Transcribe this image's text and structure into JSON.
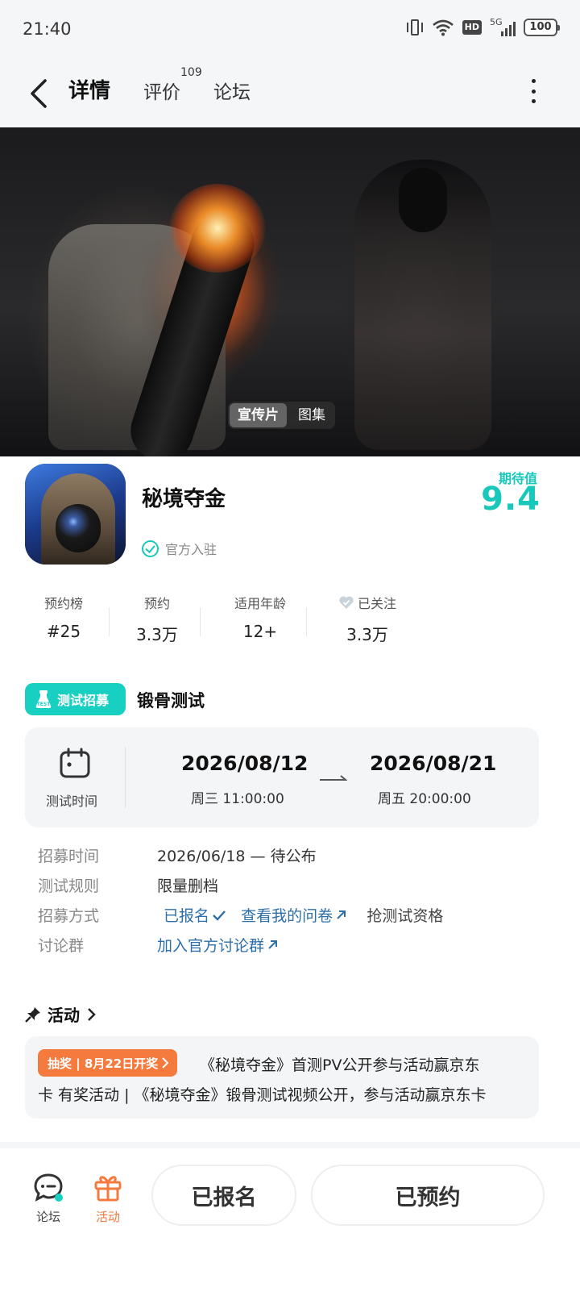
{
  "status_bar": {
    "time": "21:40",
    "hd": "HD",
    "network": "5G",
    "battery": "100"
  },
  "nav": {
    "tabs": [
      {
        "label": "详情"
      },
      {
        "label": "评价"
      },
      {
        "label": "论坛"
      }
    ],
    "review_count": "109"
  },
  "hero": {
    "media_tabs": [
      {
        "label": "宣传片"
      },
      {
        "label": "图集"
      }
    ]
  },
  "game": {
    "title": "秘境夺金",
    "official": "官方入驻",
    "expect_label": "期待值",
    "expect_score": "9.4"
  },
  "stats": [
    {
      "label": "预约榜",
      "value": "#25"
    },
    {
      "label": "预约",
      "value": "3.3万"
    },
    {
      "label": "适用年龄",
      "value": "12+"
    },
    {
      "label": "已关注",
      "value": "3.3万"
    }
  ],
  "test": {
    "badge": "测试招募",
    "name": "锻骨测试",
    "time_label": "测试时间",
    "start_date": "2026/08/12",
    "start_sub": "周三  11:00:00",
    "end_date": "2026/08/21",
    "end_sub": "周五  20:00:00",
    "details": [
      {
        "label": "招募时间",
        "value": "2026/06/18 — 待公布"
      },
      {
        "label": "测试规则",
        "value": "限量删档"
      },
      {
        "label": "招募方式",
        "signed": "已报名",
        "questionnaire": "查看我的问卷",
        "grab": "抢测试资格"
      },
      {
        "label": "讨论群",
        "value": "加入官方讨论群"
      }
    ]
  },
  "activity": {
    "title": "活动",
    "badge": "抽奖 | 8月22日开奖",
    "line1": "《秘境夺金》首测PV公开参与活动赢京东",
    "line2": "卡 有奖活动 | 《秘境夺金》锻骨测试视频公开，参与活动赢京东卡"
  },
  "bottom_bar": {
    "forum": "论坛",
    "activity": "活动",
    "signed_button": "已报名",
    "reserved_button": "已预约"
  },
  "colors": {
    "accent": "#17d0c2",
    "orange": "#f47a3d",
    "link": "#2d6fa8"
  }
}
